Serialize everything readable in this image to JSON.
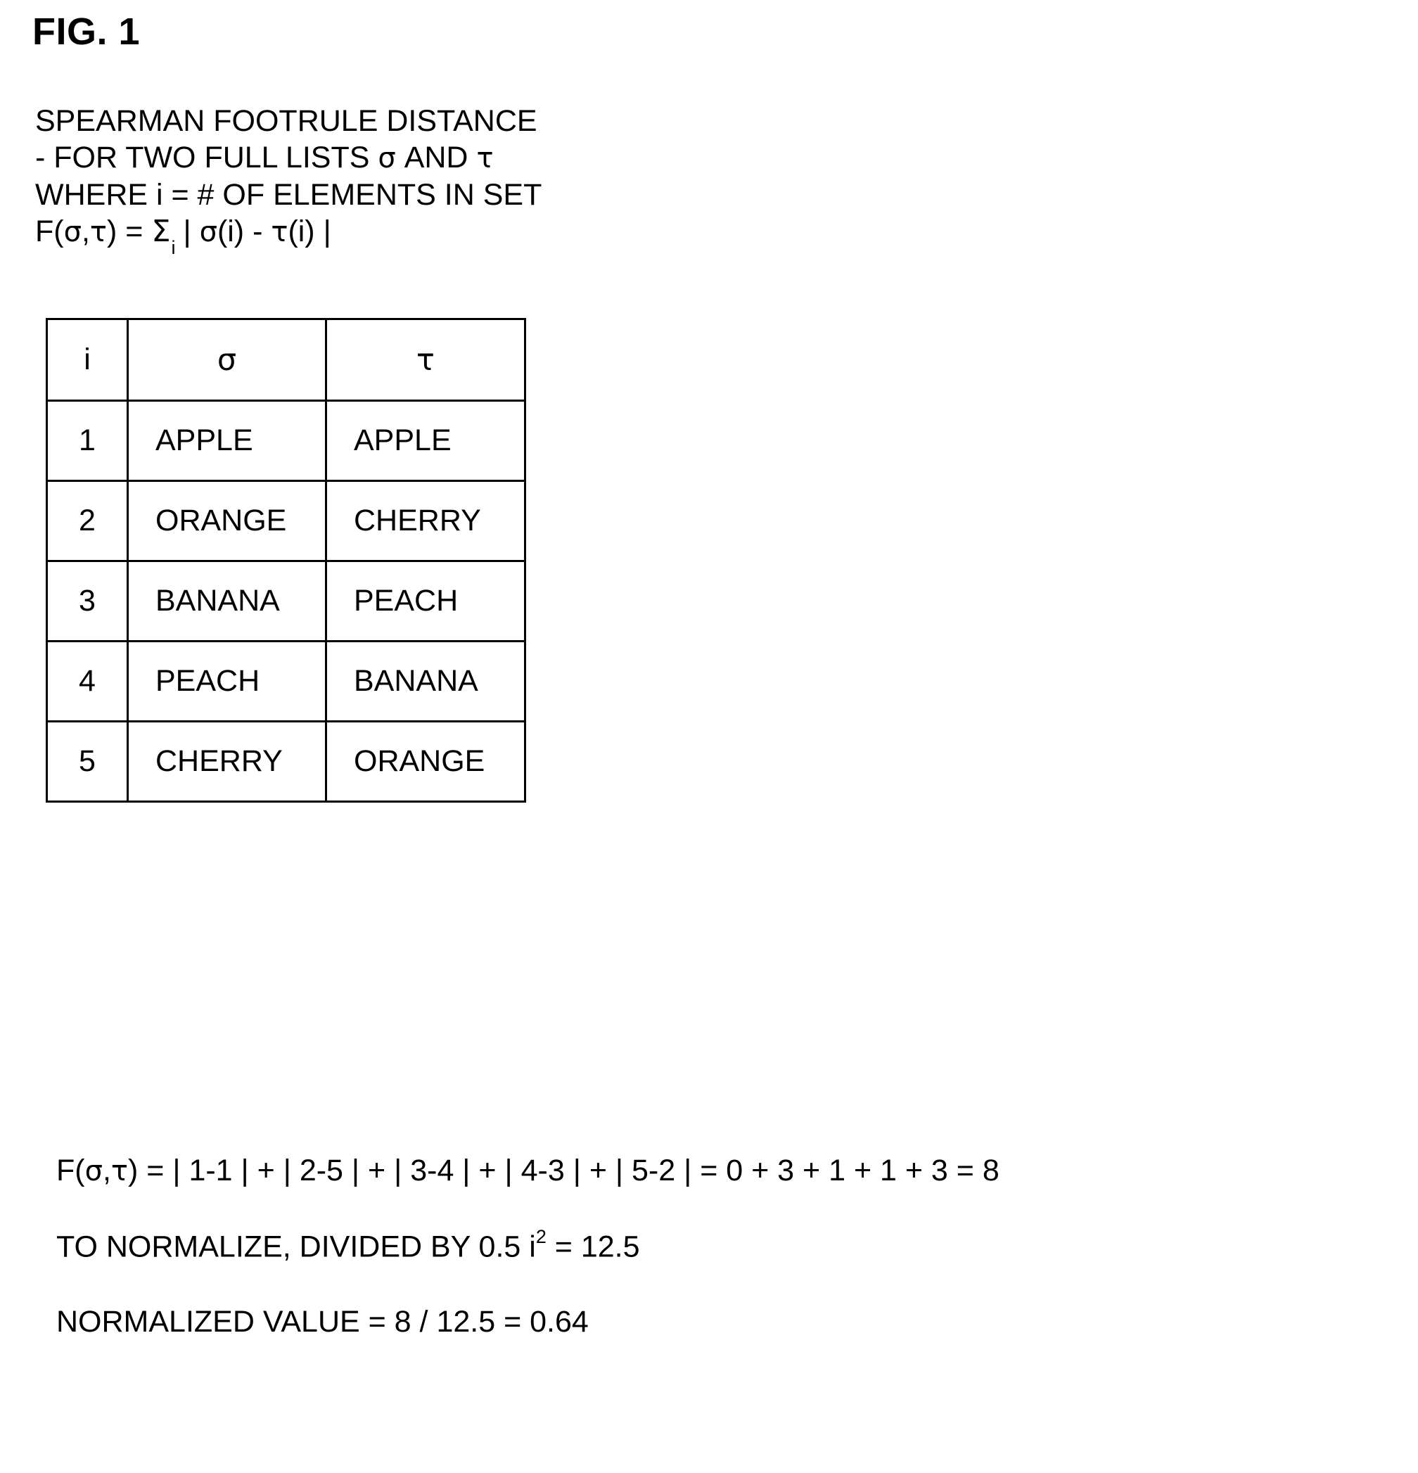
{
  "figure": {
    "label": "FIG. 1"
  },
  "description": {
    "line1": "SPEARMAN FOOTRULE DISTANCE",
    "line2_pre": "- FOR TWO FULL LISTS ",
    "line2_sigma": "σ",
    "line2_mid": " AND ",
    "line2_tau": "τ",
    "line3": "WHERE  i = # OF ELEMENTS IN SET",
    "line4_f": "F(",
    "line4_sigma": "σ",
    "line4_comma": ",",
    "line4_tau": "τ",
    "line4_eq": ") = ",
    "line4_sigma_sum": "Σ",
    "line4_sub": "i",
    "line4_bar1": " | ",
    "line4_sigma2": "σ",
    "line4_i1": "(i) - ",
    "line4_tau2": "τ",
    "line4_i2": "(i) |"
  },
  "table": {
    "headers": {
      "index": "i",
      "sigma": "σ",
      "tau": "τ"
    },
    "rows": [
      {
        "index": "1",
        "sigma": "APPLE",
        "tau": "APPLE"
      },
      {
        "index": "2",
        "sigma": "ORANGE",
        "tau": "CHERRY"
      },
      {
        "index": "3",
        "sigma": "BANANA",
        "tau": "PEACH"
      },
      {
        "index": "4",
        "sigma": "PEACH",
        "tau": "BANANA"
      },
      {
        "index": "5",
        "sigma": "CHERRY",
        "tau": "ORANGE"
      }
    ]
  },
  "calculations": {
    "line1_f": "F(",
    "line1_sigma": "σ",
    "line1_comma": ",",
    "line1_tau": "τ",
    "line1_rest": ") = | 1-1 | + | 2-5 | + | 3-4 | + | 4-3 | + | 5-2 | = 0 + 3 + 1 + 1 + 3 = 8",
    "line2_pre": "TO NORMALIZE, DIVIDED BY 0.5 i",
    "line2_sup": "2",
    "line2_post": " = 12.5",
    "line3": "NORMALIZED VALUE = 8 / 12.5 = 0.64"
  },
  "chart_data": {
    "type": "table",
    "title": "Spearman Footrule Distance example",
    "columns": [
      "i",
      "σ",
      "τ"
    ],
    "rows": [
      [
        "1",
        "APPLE",
        "APPLE"
      ],
      [
        "2",
        "ORANGE",
        "CHERRY"
      ],
      [
        "3",
        "BANANA",
        "PEACH"
      ],
      [
        "4",
        "PEACH",
        "BANANA"
      ],
      [
        "5",
        "CHERRY",
        "ORANGE"
      ]
    ],
    "sigma_positions": {
      "APPLE": 1,
      "ORANGE": 2,
      "BANANA": 3,
      "PEACH": 4,
      "CHERRY": 5
    },
    "tau_positions": {
      "APPLE": 1,
      "CHERRY": 2,
      "PEACH": 3,
      "BANANA": 4,
      "ORANGE": 5
    },
    "term_differences": [
      0,
      3,
      1,
      1,
      3
    ],
    "footrule_distance": 8,
    "normalizer": 12.5,
    "normalized_value": 0.64
  },
  "colors": {
    "background": "#ffffff",
    "ink": "#000000"
  }
}
